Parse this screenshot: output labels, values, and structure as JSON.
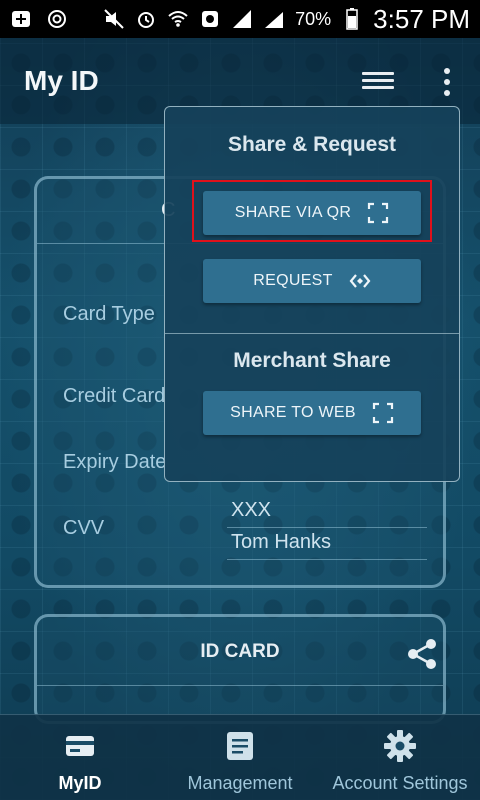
{
  "status_bar": {
    "battery": "70%",
    "time": "3:57 PM"
  },
  "app_bar": {
    "title": "My ID"
  },
  "card": {
    "header_text": "C",
    "rows": [
      {
        "label": "Card Type",
        "value": ""
      },
      {
        "label": "Credit Card",
        "value": ""
      },
      {
        "label": "Expiry Date",
        "value": ""
      },
      {
        "label": "CVV",
        "value": "XXX"
      }
    ],
    "holder_name": "Tom Hanks"
  },
  "id_card": {
    "title": "ID CARD"
  },
  "popup": {
    "section1_title": "Share & Request",
    "share_qr_label": "SHARE VIA QR",
    "request_label": "REQUEST",
    "section2_title": "Merchant Share",
    "share_web_label": "SHARE TO WEB"
  },
  "bottom_nav": {
    "items": [
      {
        "label": "MyID",
        "icon": "card-icon",
        "active": true
      },
      {
        "label": "Management",
        "icon": "document-icon",
        "active": false
      },
      {
        "label": "Account Settings",
        "icon": "gear-icon",
        "active": false
      }
    ]
  },
  "colors": {
    "highlight": "#e0111b",
    "button": "#2f6f90",
    "popup_bg": "#16425a"
  }
}
